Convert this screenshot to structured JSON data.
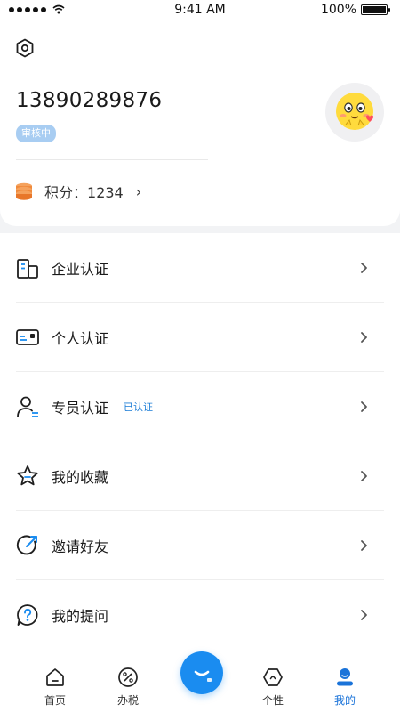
{
  "status_bar": {
    "time": "9:41 AM",
    "battery_text": "100%",
    "signal_icon": "signal-dots-icon",
    "wifi_icon": "wifi-icon",
    "battery_icon": "battery-icon"
  },
  "profile": {
    "settings_icon": "gear-hexagon-icon",
    "phone": "13890289876",
    "status_badge": "审核中",
    "avatar_icon": "emoji-avatar-icon",
    "points_icon": "coin-stack-icon",
    "points_label": "积分：",
    "points_value": "1234",
    "points_chevron": "›"
  },
  "menu": {
    "items": [
      {
        "label": "企业认证",
        "icon": "building-icon",
        "tag": ""
      },
      {
        "label": "个人认证",
        "icon": "id-card-icon",
        "tag": ""
      },
      {
        "label": "专员认证",
        "icon": "user-badge-icon",
        "tag": "已认证"
      },
      {
        "label": "我的收藏",
        "icon": "star-icon",
        "tag": ""
      },
      {
        "label": "邀请好友",
        "icon": "share-arrow-icon",
        "tag": ""
      },
      {
        "label": "我的提问",
        "icon": "question-icon",
        "tag": ""
      }
    ]
  },
  "tabbar": {
    "tabs": [
      {
        "label": "首页",
        "icon": "home-icon",
        "active": false
      },
      {
        "label": "办税",
        "icon": "percent-icon",
        "active": false
      },
      {
        "label": "个性",
        "icon": "hexagon-icon",
        "active": false
      },
      {
        "label": "我的",
        "icon": "person-icon",
        "active": true
      }
    ],
    "center_icon": "chat-bubble-icon"
  },
  "colors": {
    "accent": "#1a8cf0",
    "active_tab": "#1a73d9",
    "badge_bg": "#a8cdf2",
    "tag_text": "#1b7cd6",
    "coin": "#f08a3c"
  }
}
